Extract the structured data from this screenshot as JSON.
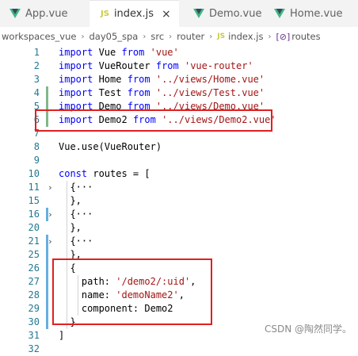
{
  "tabs": [
    {
      "label": "App.vue",
      "icon": "vue-icon",
      "active": false
    },
    {
      "label": "index.js",
      "icon": "js-icon",
      "active": true,
      "close": "×"
    },
    {
      "label": "Demo.vue",
      "icon": "vue-icon",
      "active": false
    },
    {
      "label": "Home.vue",
      "icon": "vue-icon",
      "active": false
    }
  ],
  "breadcrumb": {
    "parts": [
      "workspaces_vue",
      "day05_spa",
      "src",
      "router",
      "index.js",
      "routes"
    ],
    "js_badge": "JS",
    "symbol_badge": "[⊘]"
  },
  "code_lines": [
    {
      "n": "1",
      "tokens": [
        [
          "kw",
          "import"
        ],
        [
          "",
          " Vue "
        ],
        [
          "kw",
          "from"
        ],
        [
          "",
          " "
        ],
        [
          "str",
          "'vue'"
        ]
      ]
    },
    {
      "n": "2",
      "tokens": [
        [
          "kw",
          "import"
        ],
        [
          "",
          " VueRouter "
        ],
        [
          "kw",
          "from"
        ],
        [
          "",
          " "
        ],
        [
          "str",
          "'vue-router'"
        ]
      ]
    },
    {
      "n": "3",
      "tokens": [
        [
          "kw",
          "import"
        ],
        [
          "",
          " Home "
        ],
        [
          "kw",
          "from"
        ],
        [
          "",
          " "
        ],
        [
          "str",
          "'../views/Home.vue'"
        ]
      ]
    },
    {
      "n": "4",
      "tokens": [
        [
          "kw",
          "import"
        ],
        [
          "",
          " Test "
        ],
        [
          "kw",
          "from"
        ],
        [
          "",
          " "
        ],
        [
          "str",
          "'../views/Test.vue'"
        ]
      ]
    },
    {
      "n": "5",
      "tokens": [
        [
          "kw",
          "import"
        ],
        [
          "",
          " Demo "
        ],
        [
          "kw",
          "from"
        ],
        [
          "",
          " "
        ],
        [
          "str",
          "'../views/Demo.vue'"
        ]
      ]
    },
    {
      "n": "6",
      "tokens": [
        [
          "kw",
          "import"
        ],
        [
          "",
          " Demo2 "
        ],
        [
          "kw",
          "from"
        ],
        [
          "",
          " "
        ],
        [
          "str",
          "'../views/Demo2.vue'"
        ]
      ]
    },
    {
      "n": "7",
      "tokens": []
    },
    {
      "n": "8",
      "tokens": [
        [
          "",
          "Vue.use(VueRouter)"
        ]
      ]
    },
    {
      "n": "9",
      "tokens": []
    },
    {
      "n": "10",
      "tokens": [
        [
          "kw",
          "const"
        ],
        [
          "",
          " routes = ["
        ]
      ]
    },
    {
      "n": "11",
      "tokens": [
        [
          "",
          "  {···"
        ]
      ],
      "fold": "›"
    },
    {
      "n": "15",
      "tokens": [
        [
          "",
          "  },"
        ]
      ]
    },
    {
      "n": "16",
      "tokens": [
        [
          "",
          "  {···"
        ]
      ],
      "fold": "›"
    },
    {
      "n": "20",
      "tokens": [
        [
          "",
          "  },"
        ]
      ]
    },
    {
      "n": "21",
      "tokens": [
        [
          "",
          "  {···"
        ]
      ],
      "fold": "›"
    },
    {
      "n": "25",
      "tokens": [
        [
          "",
          "  },"
        ]
      ]
    },
    {
      "n": "26",
      "tokens": [
        [
          "",
          "  {"
        ]
      ]
    },
    {
      "n": "27",
      "tokens": [
        [
          "",
          "    path: "
        ],
        [
          "str",
          "'/demo2/:uid'"
        ],
        [
          "",
          ","
        ]
      ]
    },
    {
      "n": "28",
      "tokens": [
        [
          "",
          "    name: "
        ],
        [
          "str",
          "'demoName2'"
        ],
        [
          "",
          ","
        ]
      ]
    },
    {
      "n": "29",
      "tokens": [
        [
          "",
          "    component: Demo2"
        ]
      ]
    },
    {
      "n": "30",
      "tokens": [
        [
          "",
          "  }"
        ]
      ]
    },
    {
      "n": "31",
      "tokens": [
        [
          "",
          "]"
        ]
      ]
    },
    {
      "n": "32",
      "tokens": []
    }
  ],
  "colors": {
    "keyword": "#0000ff",
    "string": "#a31515",
    "line_number": "#237893",
    "annotation_box": "#e02020",
    "modified_gutter": "#66afe0",
    "added_gutter": "#81b88b"
  },
  "watermark": "CSDN @陶然同学。"
}
